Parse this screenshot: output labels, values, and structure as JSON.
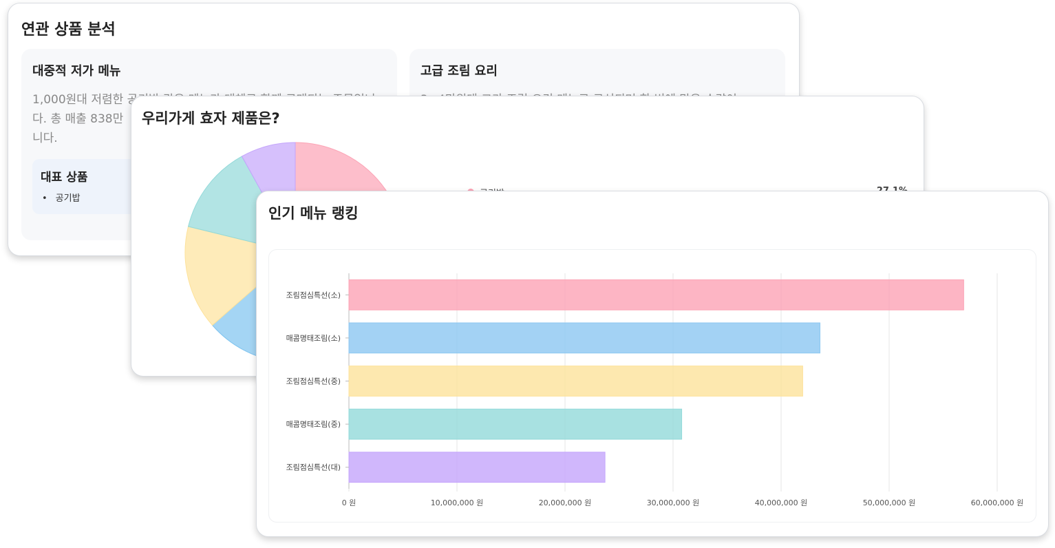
{
  "card_related": {
    "title": "연관 상품 분석",
    "left_panel": {
      "title": "대중적 저가 메뉴",
      "desc_line1": "1,000원대 저렴한 공기밥 같은 메뉴가 대체로 함께 구매되는 주문입니",
      "desc_line2": "다. 총 매출 838만",
      "desc_line3": "니다.",
      "rep_title": "대표 상품",
      "rep_item": "공기밥"
    },
    "right_panel": {
      "title": "고급 조림 요리",
      "desc_line1": "3~4만원대 고가 조림 요리 메뉴로 구성되며 한 번에 많은 수량이"
    }
  },
  "card_pie": {
    "title": "우리가게 효자 제품은?",
    "legend_label": "공기밥",
    "legend_pct": "27.1%"
  },
  "card_bar": {
    "title": "인기 메뉴 랭킹"
  },
  "chart_data": [
    {
      "type": "pie",
      "values": [
        27.1,
        17.5,
        15.4,
        14.4,
        12.4,
        7.6
      ],
      "colors": [
        "#fca3b5",
        "#a855f7",
        "#7ec3ef",
        "#fde29b",
        "#92d9d9",
        "#c4a5fb"
      ],
      "legend": [
        "공기밥"
      ]
    },
    {
      "type": "bar",
      "orientation": "horizontal",
      "categories": [
        "조림점심특선(소)",
        "매콤명태조림(소)",
        "조림점심특선(중)",
        "매콤명태조림(중)",
        "조림점심특선(대)"
      ],
      "values": [
        56900000,
        43600000,
        42000000,
        30800000,
        23700000
      ],
      "colors": [
        "#fca3b5",
        "#8cc7f1",
        "#fde29b",
        "#92d9d9",
        "#c4a5fb"
      ],
      "xlim": [
        0,
        60000000
      ],
      "x_ticks": [
        "0 원",
        "10,000,000 원",
        "20,000,000 원",
        "30,000,000 원",
        "40,000,000 원",
        "50,000,000 원",
        "60,000,000 원"
      ],
      "grid": true
    }
  ]
}
